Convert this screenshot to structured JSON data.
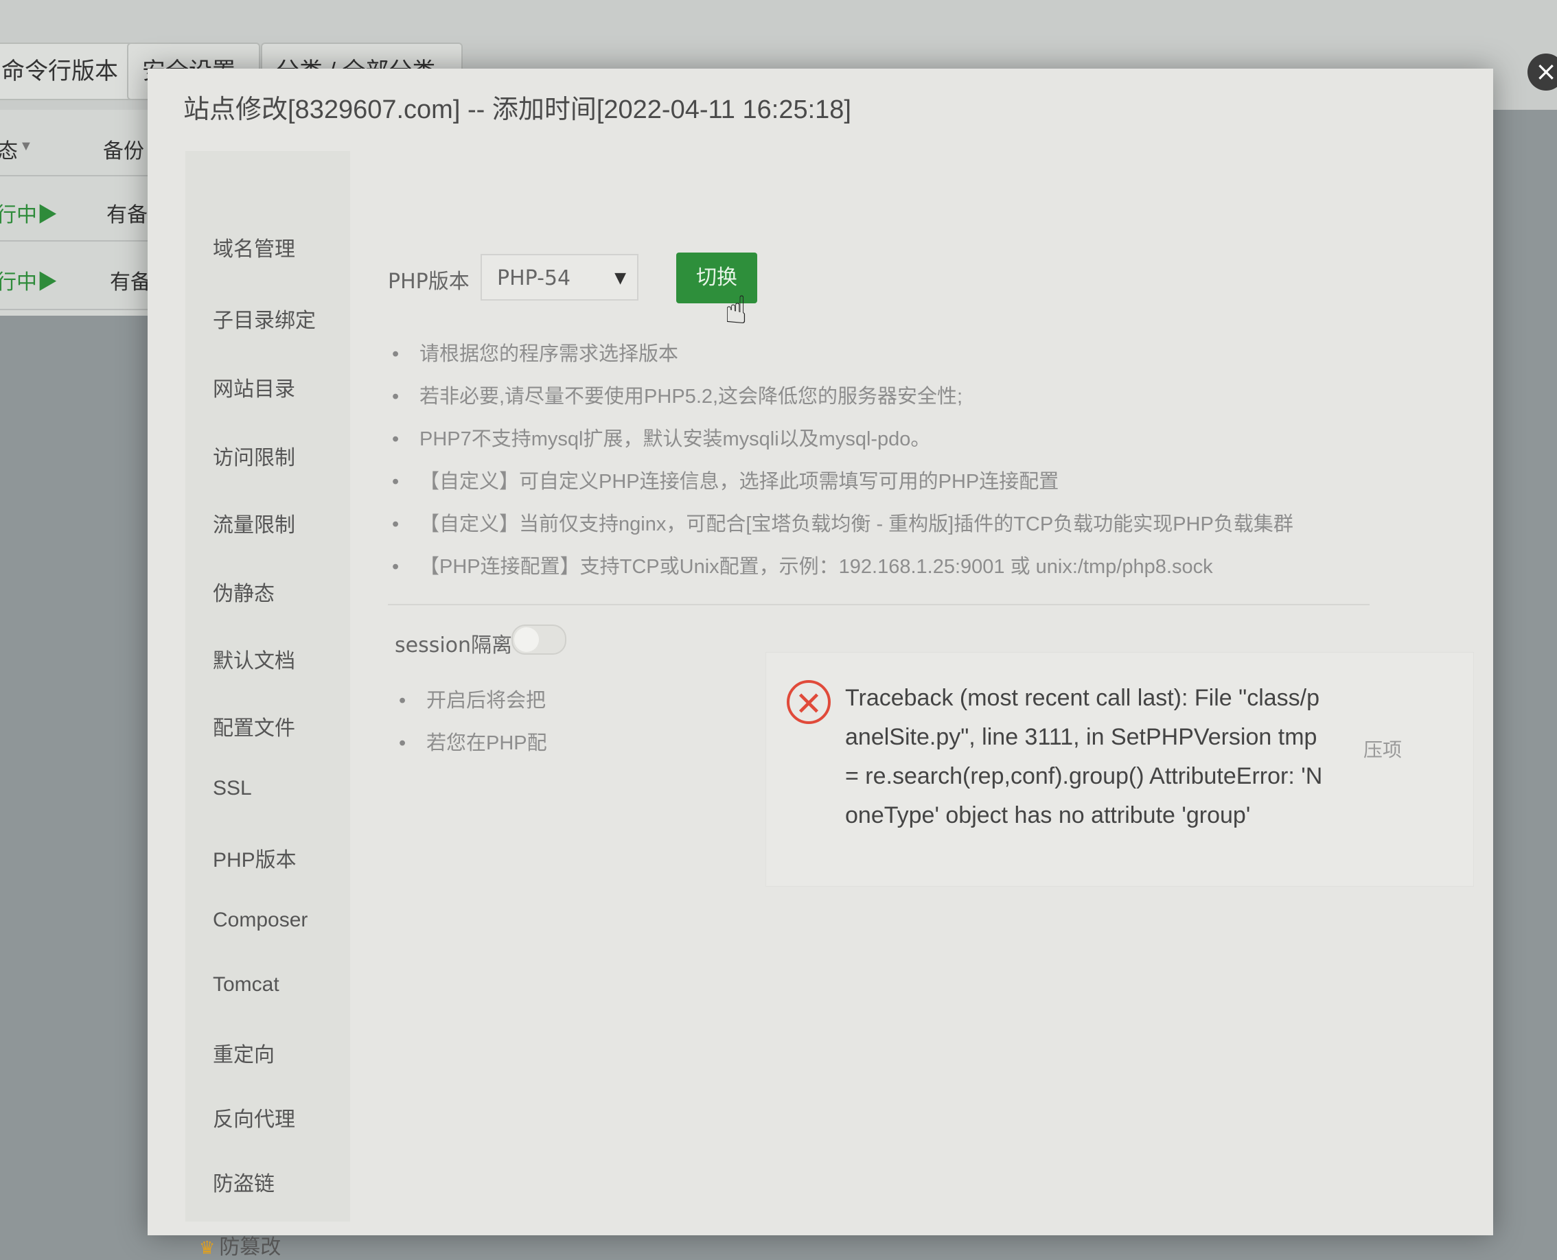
{
  "background": {
    "toolbar_buttons": [
      "命令行版本",
      "安全设置",
      "分类 / 全部分类"
    ],
    "columns": {
      "status": "态",
      "backup": "备份"
    },
    "rows": [
      {
        "status": "行中▶",
        "backup": "有备"
      },
      {
        "status": "行中▶",
        "backup": "有备"
      }
    ]
  },
  "modal": {
    "title": "站点修改[8329607.com] -- 添加时间[2022-04-11 16:25:18]",
    "close_glyph": "×",
    "sidebar": [
      "域名管理",
      "子目录绑定",
      "网站目录",
      "访问限制",
      "流量限制",
      "伪静态",
      "默认文档",
      "配置文件",
      "SSL",
      "PHP版本",
      "Composer",
      "Tomcat",
      "重定向",
      "反向代理",
      "防盗链",
      "防篡改"
    ],
    "php": {
      "label": "PHP版本",
      "selected": "PHP-54",
      "switch_label": "切换"
    },
    "tips": [
      "请根据您的程序需求选择版本",
      "若非必要,请尽量不要使用PHP5.2,这会降低您的服务器安全性;",
      "PHP7不支持mysql扩展，默认安装mysqli以及mysql-pdo。",
      "【自定义】可自定义PHP连接信息，选择此项需填写可用的PHP连接配置",
      "【自定义】当前仅支持nginx，可配合[宝塔负载均衡 - 重构版]插件的TCP负载功能实现PHP负载集群",
      "【PHP连接配置】支持TCP或Unix配置，示例：192.168.1.25:9001 或 unix:/tmp/php8.sock"
    ],
    "session": {
      "label": "session隔离",
      "tips": [
        "开启后将会把",
        "若您在PHP配"
      ]
    },
    "error": {
      "glyph": "✕",
      "message": "Traceback (most recent call last): File \"class/panelSite.py\", line 3111, in SetPHPVersion tmp = re.search(rep,conf).group() AttributeError: 'NoneType' object has no attribute 'group'",
      "side_text": "压项"
    }
  }
}
